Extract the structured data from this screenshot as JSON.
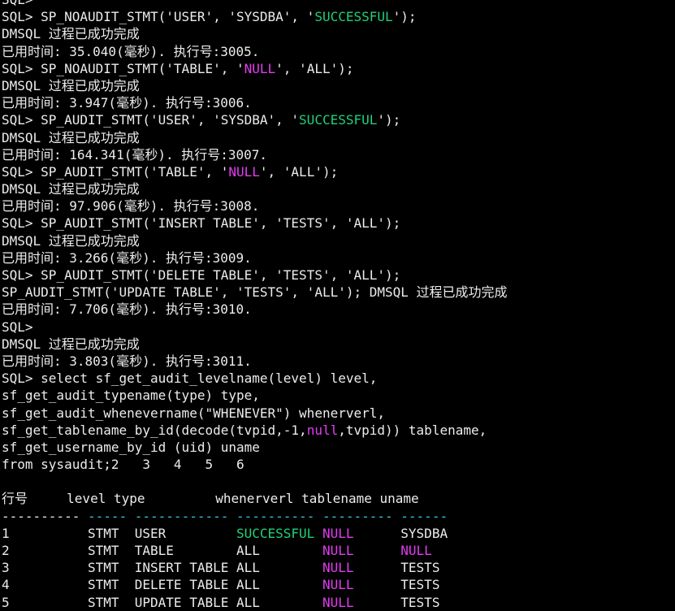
{
  "terminal": {
    "lines": [
      [
        {
          "t": "SQL>",
          "c": "white"
        }
      ],
      [
        {
          "t": "SQL> SP_NOAUDIT_STMT('USER', 'SYSDBA', '",
          "c": "white"
        },
        {
          "t": "SUCCESSFUL",
          "c": "green"
        },
        {
          "t": "');",
          "c": "white"
        }
      ],
      [
        {
          "t": "DMSQL 过程已成功完成",
          "c": "white"
        }
      ],
      [
        {
          "t": "已用时间: 35.040(毫秒). 执行号:3005.",
          "c": "white"
        }
      ],
      [
        {
          "t": "SQL> SP_NOAUDIT_STMT('TABLE', '",
          "c": "white"
        },
        {
          "t": "NULL",
          "c": "magenta"
        },
        {
          "t": "', 'ALL');",
          "c": "white"
        }
      ],
      [
        {
          "t": "DMSQL 过程已成功完成",
          "c": "white"
        }
      ],
      [
        {
          "t": "已用时间: 3.947(毫秒). 执行号:3006.",
          "c": "white"
        }
      ],
      [
        {
          "t": "SQL> SP_AUDIT_STMT('USER', 'SYSDBA', '",
          "c": "white"
        },
        {
          "t": "SUCCESSFUL",
          "c": "green"
        },
        {
          "t": "');",
          "c": "white"
        }
      ],
      [
        {
          "t": "DMSQL 过程已成功完成",
          "c": "white"
        }
      ],
      [
        {
          "t": "已用时间: 164.341(毫秒). 执行号:3007.",
          "c": "white"
        }
      ],
      [
        {
          "t": "SQL> SP_AUDIT_STMT('TABLE', '",
          "c": "white"
        },
        {
          "t": "NULL",
          "c": "magenta"
        },
        {
          "t": "', 'ALL');",
          "c": "white"
        }
      ],
      [
        {
          "t": "DMSQL 过程已成功完成",
          "c": "white"
        }
      ],
      [
        {
          "t": "已用时间: 97.906(毫秒). 执行号:3008.",
          "c": "white"
        }
      ],
      [
        {
          "t": "SQL> SP_AUDIT_STMT('INSERT TABLE', 'TESTS', 'ALL');",
          "c": "white"
        }
      ],
      [
        {
          "t": "DMSQL 过程已成功完成",
          "c": "white"
        }
      ],
      [
        {
          "t": "已用时间: 3.266(毫秒). 执行号:3009.",
          "c": "white"
        }
      ],
      [
        {
          "t": "SQL> SP_AUDIT_STMT('DELETE TABLE', 'TESTS', 'ALL');",
          "c": "white"
        }
      ],
      [
        {
          "t": "SP_AUDIT_STMT('UPDATE TABLE', 'TESTS', 'ALL'); DMSQL 过程已成功完成",
          "c": "white"
        }
      ],
      [
        {
          "t": "已用时间: 7.706(毫秒). 执行号:3010.",
          "c": "white"
        }
      ],
      [
        {
          "t": "SQL>",
          "c": "white"
        }
      ],
      [
        {
          "t": "DMSQL 过程已成功完成",
          "c": "white"
        }
      ],
      [
        {
          "t": "已用时间: 3.803(毫秒). 执行号:3011.",
          "c": "white"
        }
      ],
      [
        {
          "t": "SQL> select sf_get_audit_levelname(level) level,",
          "c": "white"
        }
      ],
      [
        {
          "t": "sf_get_audit_typename(type) type,",
          "c": "white"
        }
      ],
      [
        {
          "t": "sf_get_audit_whenevername(\"WHENEVER\") whenerverl,",
          "c": "white"
        }
      ],
      [
        {
          "t": "sf_get_tablename_by_id(decode(tvpid,-1,",
          "c": "white"
        },
        {
          "t": "null",
          "c": "magenta"
        },
        {
          "t": ",tvpid)) tablename,",
          "c": "white"
        }
      ],
      [
        {
          "t": "sf_get_username_by_id (uid) uname",
          "c": "white"
        }
      ],
      [
        {
          "t": "from sysaudit;2   3   4   5   6",
          "c": "white"
        }
      ],
      [
        {
          "t": "",
          "c": "white"
        }
      ],
      [
        {
          "t": "行号     level type         whenerverl tablename uname",
          "c": "white"
        }
      ],
      [
        {
          "t": "---------- ",
          "c": "white"
        },
        {
          "t": "----- ------------ ---------- --------- ------",
          "c": "cyan"
        }
      ],
      [
        {
          "t": "1          STMT  USER         ",
          "c": "white"
        },
        {
          "t": "SUCCESSFUL NULL",
          "c": "green_magenta"
        },
        {
          "t": "      SYSDBA",
          "c": "white"
        }
      ],
      [
        {
          "t": "2          STMT  TABLE        ALL        ",
          "c": "white"
        },
        {
          "t": "NULL",
          "c": "magenta"
        },
        {
          "t": "      ",
          "c": "white"
        },
        {
          "t": "NULL",
          "c": "magenta"
        }
      ],
      [
        {
          "t": "3          STMT  INSERT TABLE ALL        ",
          "c": "white"
        },
        {
          "t": "NULL",
          "c": "magenta"
        },
        {
          "t": "      TESTS",
          "c": "white"
        }
      ],
      [
        {
          "t": "4          STMT  DELETE TABLE ALL        ",
          "c": "white"
        },
        {
          "t": "NULL",
          "c": "magenta"
        },
        {
          "t": "      TESTS",
          "c": "white"
        }
      ],
      [
        {
          "t": "5          STMT  UPDATE TABLE ALL        ",
          "c": "white"
        },
        {
          "t": "NULL",
          "c": "magenta"
        },
        {
          "t": "      TESTS",
          "c": "white"
        }
      ]
    ]
  },
  "colors": {
    "background": "#000000",
    "text": "#ececec",
    "green": "#21d07a",
    "magenta": "#e43cf2",
    "cyan": "#33c8d8"
  }
}
